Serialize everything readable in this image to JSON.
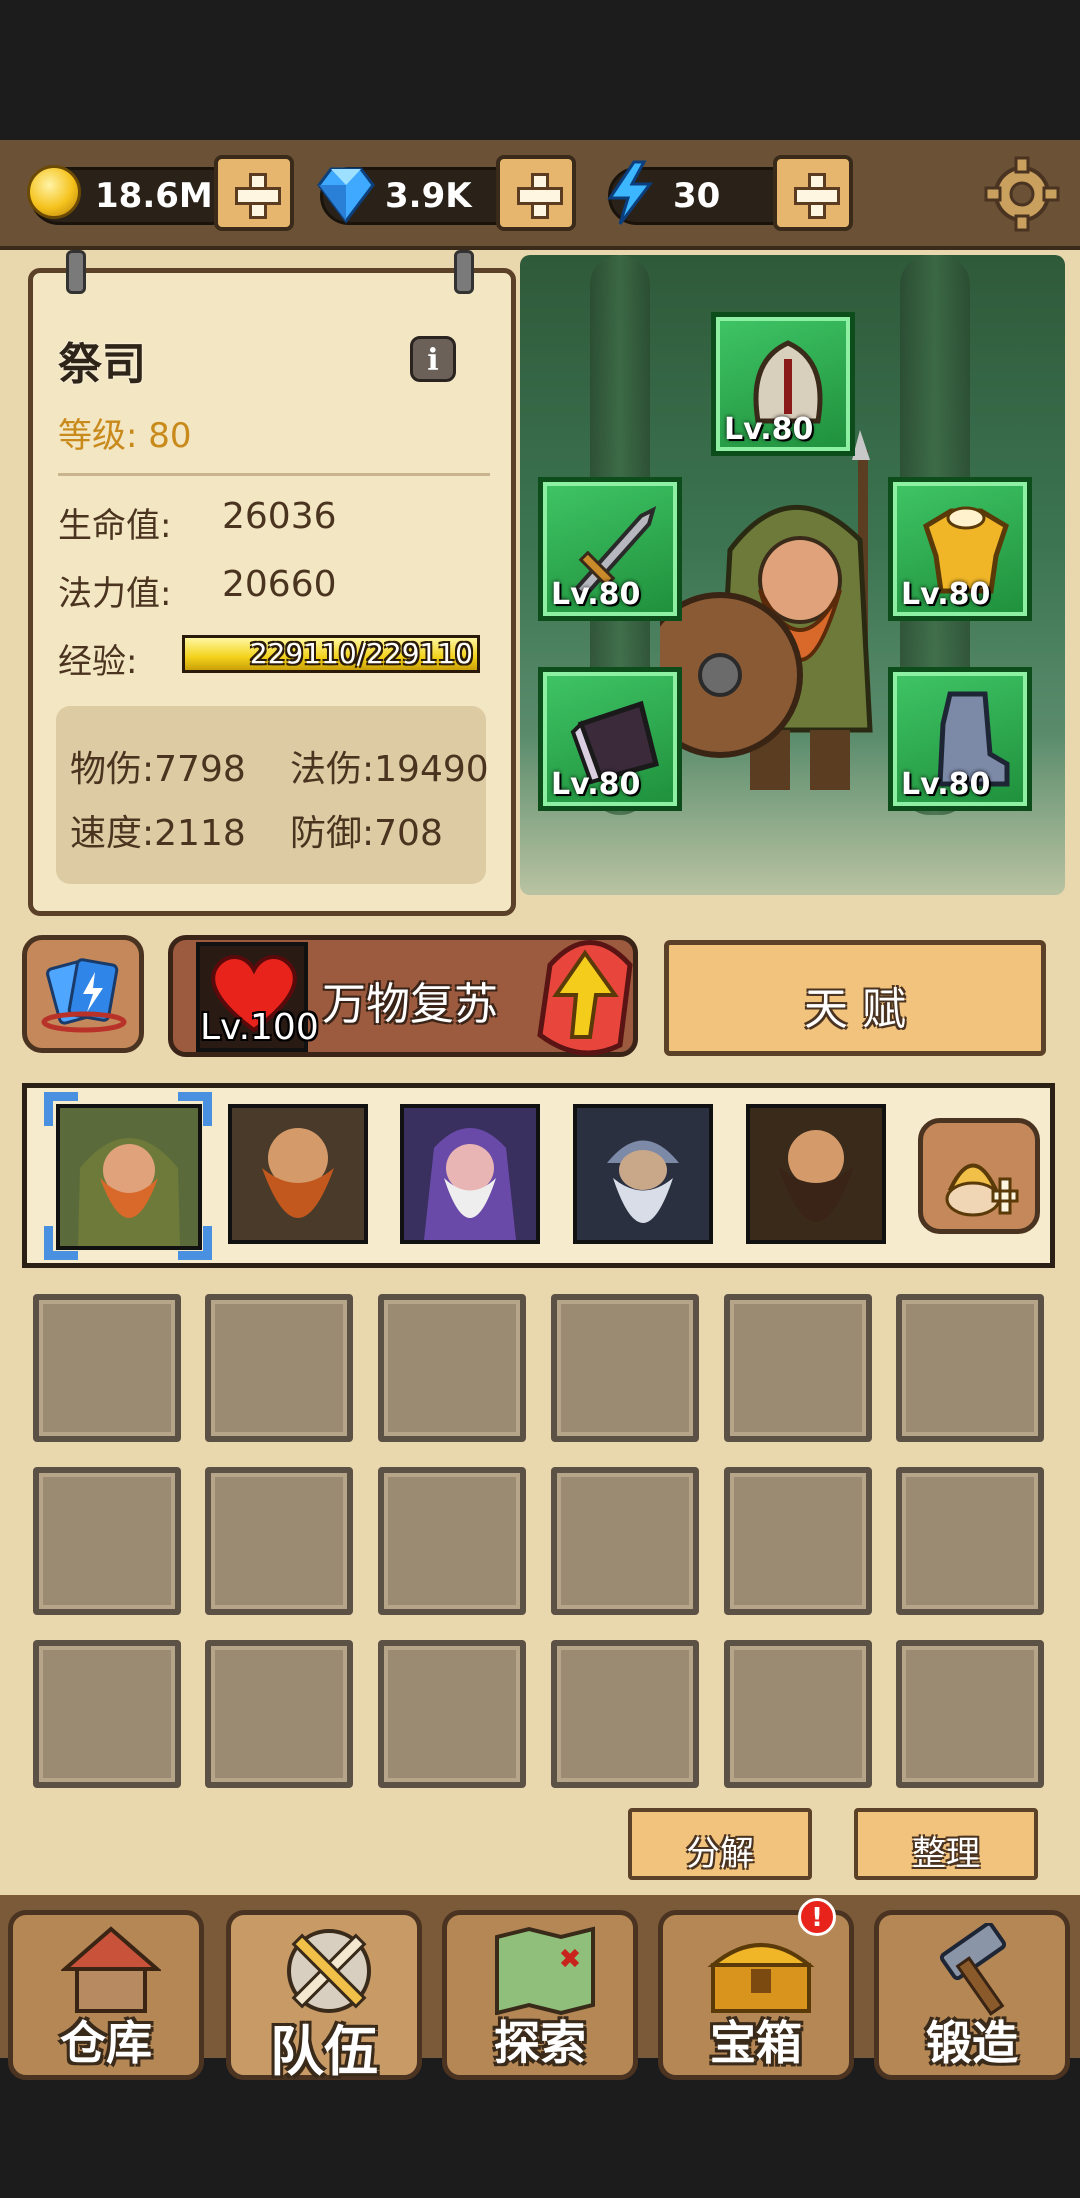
{
  "resources": {
    "gold": "18.6M",
    "diamonds": "3.9K",
    "energy": "30"
  },
  "hero": {
    "name": "祭司",
    "level_label": "等级: 80",
    "hp_label": "生命值:",
    "hp_value": "26036",
    "mp_label": "法力值:",
    "mp_value": "20660",
    "exp_label": "经验:",
    "exp_text": "229110/229110",
    "exp_fraction": 1.0,
    "stats": {
      "phys_atk": "物伤:7798",
      "mag_atk": "法伤:19490",
      "speed": "速度:2118",
      "defense": "防御:708"
    }
  },
  "equipment": {
    "helmet": "Lv.80",
    "weapon": "Lv.80",
    "armor": "Lv.80",
    "gloves": "Lv.80",
    "boots": "Lv.80"
  },
  "skill": {
    "name": "万物复苏",
    "level": "Lv.100"
  },
  "talent_button": "天 赋",
  "inventory": {
    "decompose": "分解",
    "sort": "整理"
  },
  "nav": {
    "warehouse": "仓库",
    "team": "队伍",
    "explore": "探索",
    "chest": "宝箱",
    "forge": "锻造"
  },
  "colors": {
    "equip_green": "#2fb552",
    "accent_gold": "#e6b66e",
    "panel": "#f3e6c2"
  }
}
